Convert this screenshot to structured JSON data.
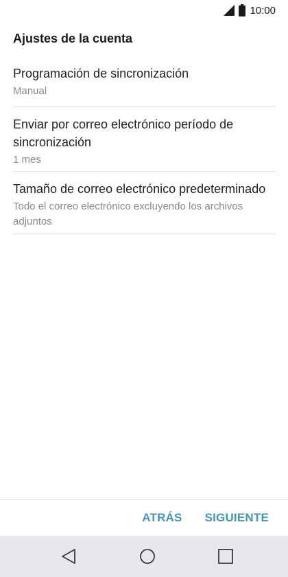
{
  "status_bar": {
    "time": "10:00",
    "icons": [
      "signal-icon",
      "battery-icon"
    ]
  },
  "header": {
    "title": "Ajustes de la cuenta"
  },
  "settings": [
    {
      "title": "Programación de sincronización",
      "value": "Manual"
    },
    {
      "title": "Enviar por correo electrónico período de sincronización",
      "value": "1 mes"
    },
    {
      "title": "Tamaño de correo electrónico predeterminado",
      "value": "Todo el correo electrónico excluyendo los archivos adjuntos"
    }
  ],
  "actions": {
    "back_label": "ATRÁS",
    "next_label": "SIGUIENTE"
  },
  "nav": {
    "icons": [
      "back-triangle-icon",
      "home-circle-icon",
      "recents-square-icon"
    ]
  },
  "colors": {
    "accent": "#3e97b8",
    "secondary_text": "#8a8a8a",
    "nav_background": "#e8e8ec"
  }
}
